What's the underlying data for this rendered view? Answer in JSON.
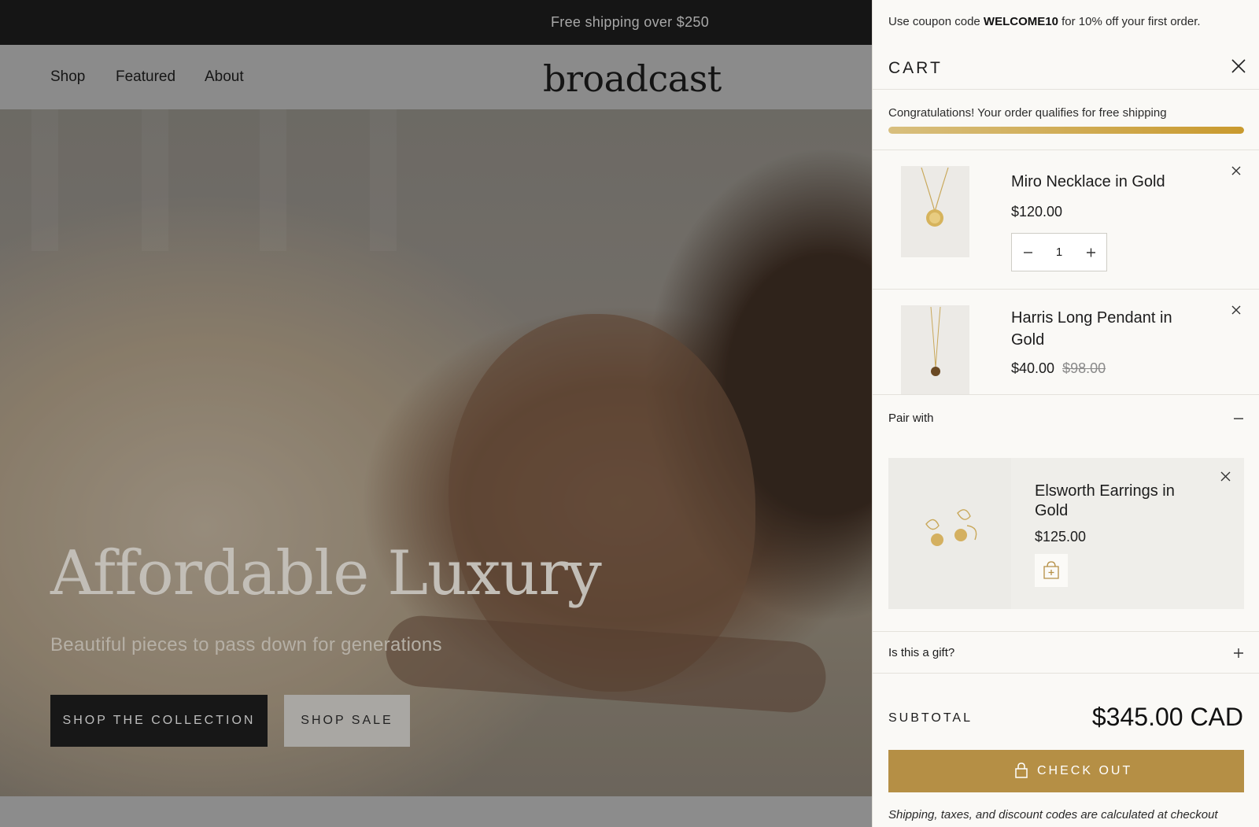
{
  "store": {
    "announcement": "Free shipping over $250",
    "nav": [
      {
        "label": "Shop"
      },
      {
        "label": "Featured"
      },
      {
        "label": "About"
      }
    ],
    "logo": "broadcast",
    "hero": {
      "title": "Affordable Luxury",
      "subtitle": "Beautiful pieces to pass down for generations",
      "primary_button": "SHOP THE COLLECTION",
      "secondary_button": "SHOP SALE"
    }
  },
  "cart": {
    "coupon": {
      "prefix": "Use coupon code ",
      "code": "WELCOME10",
      "suffix": " for 10% off your first order."
    },
    "title": "CART",
    "shipping_message": "Congratulations! Your order qualifies for free shipping",
    "shipping_progress": 1.0,
    "items": [
      {
        "name": "Miro Necklace in Gold",
        "price": "$120.00",
        "quantity": "1"
      },
      {
        "name": "Harris Long Pendant in Gold",
        "price": "$40.00",
        "compare_price": "$98.00"
      }
    ],
    "pair_with": {
      "label": "Pair with",
      "product": {
        "name": "Elsworth Earrings in Gold",
        "price": "$125.00"
      }
    },
    "gift_label": "Is this a gift?",
    "subtotal_label": "SUBTOTAL",
    "subtotal_value": "$345.00 CAD",
    "checkout_label": "CHECK OUT",
    "note": "Shipping, taxes, and discount codes are calculated at checkout"
  },
  "colors": {
    "accent_gold": "#b58f45",
    "announcement_bg": "#151515",
    "cart_bg": "#faf9f6"
  }
}
